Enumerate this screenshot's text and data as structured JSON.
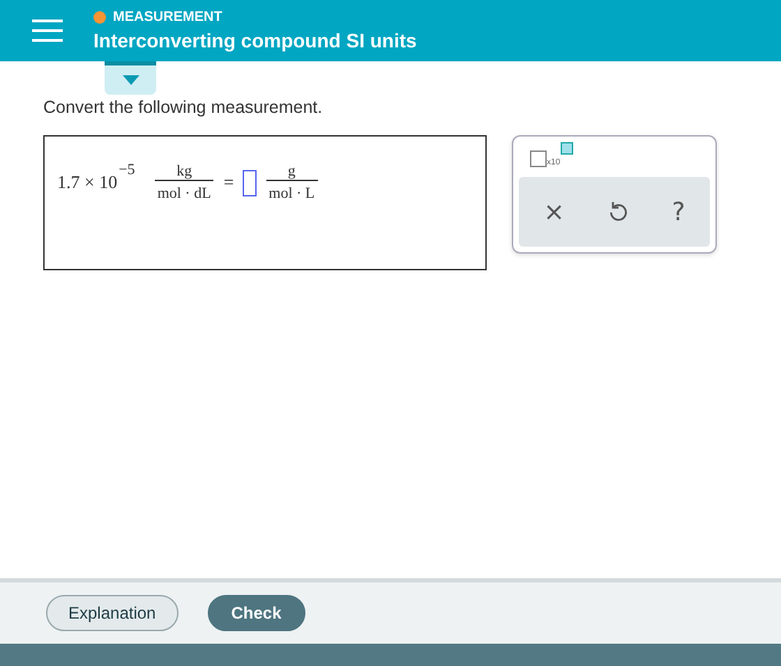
{
  "header": {
    "category": "MEASUREMENT",
    "title": "Interconverting compound SI units"
  },
  "instruction": "Convert the following measurement.",
  "equation": {
    "coefficient": "1.7",
    "times": "×",
    "base": "10",
    "exponent": "−5",
    "given_unit": {
      "numerator": "kg",
      "denominator": "mol · dL"
    },
    "equals": "=",
    "target_unit": {
      "numerator": "g",
      "denominator": "mol · L"
    }
  },
  "palette": {
    "template_label": "x10",
    "actions": [
      "×",
      "?"
    ]
  },
  "footer": {
    "buttons": [
      {
        "label": "Explanation",
        "kind": "secondary"
      },
      {
        "label": "Check",
        "kind": "primary"
      }
    ]
  }
}
